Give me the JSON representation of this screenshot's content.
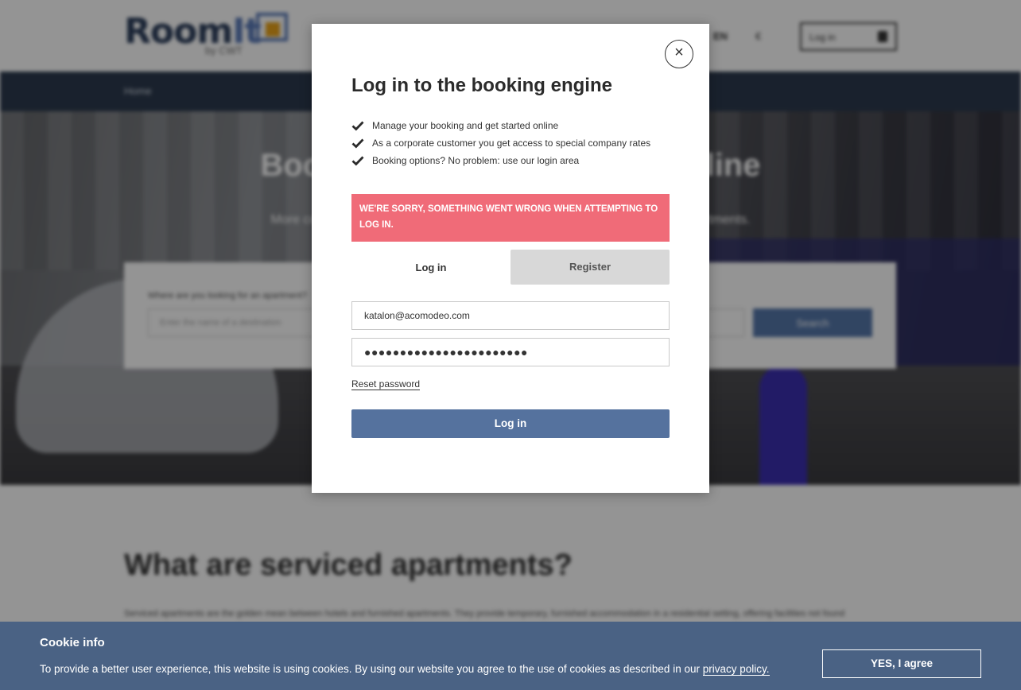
{
  "header": {
    "logo_main": "Room",
    "logo_accent": "It",
    "logo_sub": "by CWT",
    "language": "EN",
    "currency": "€",
    "login_label": "Log in"
  },
  "nav": {
    "home": "Home"
  },
  "hero": {
    "title": "Book serviced apartments online",
    "subtitle": "More comfort - less hotel: book your stay in one of our serviced business apartments.",
    "search_label": "Where are you looking for an apartment?",
    "search_placeholder": "Enter the name of a destination",
    "search_button": "Search"
  },
  "content": {
    "section_title": "What are serviced apartments?",
    "section_text": "Serviced apartments are the golden mean between hotels and furnished apartments. They provide temporary, furnished accommodation in a residential setting, offering facilities not found"
  },
  "modal": {
    "title": "Log in to the booking engine",
    "features": [
      "Manage your booking and get started online",
      "As a corporate customer you get access to special company rates",
      "Booking options? No problem: use our login area"
    ],
    "error": "WE'RE SORRY, SOMETHING WENT WRONG WHEN ATTEMPTING TO LOG IN.",
    "tab_login": "Log in",
    "tab_register": "Register",
    "email_value": "katalon@acomodeo.com",
    "password_value": "●●●●●●●●●●●●●●●●●●●●●●●",
    "reset_password": "Reset password",
    "submit_label": "Log in",
    "close_symbol": "×"
  },
  "cookie": {
    "title": "Cookie info",
    "text": "To provide a better user experience, this website is using cookies. By using our website you agree to the use of cookies as described in our",
    "link": "privacy policy.",
    "button": "YES, I agree"
  },
  "colors": {
    "accent": "#55729e",
    "error": "#f06b78",
    "cookie_bar": "#4a6284",
    "nav": "#2c3a4e"
  }
}
